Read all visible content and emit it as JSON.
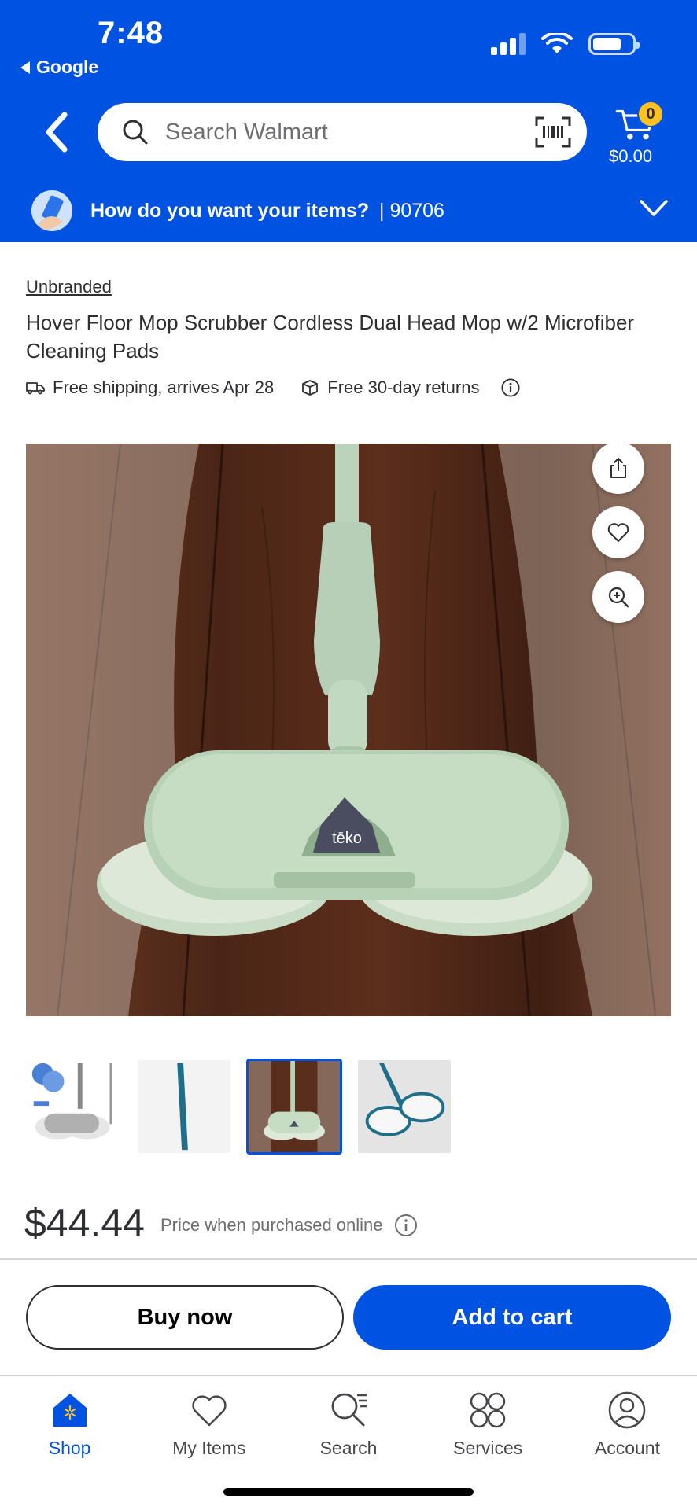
{
  "status_bar": {
    "time": "7:48",
    "back_app": "Google"
  },
  "header": {
    "search_placeholder": "Search Walmart",
    "cart_count": "0",
    "cart_total": "$0.00",
    "delivery_prompt": "How do you want your items?",
    "delivery_zip": "| 90706"
  },
  "product": {
    "brand": "Unbranded",
    "title": "Hover Floor Mop Scrubber Cordless Dual Head Mop w/2 Microfiber Cleaning Pads",
    "shipping": "Free shipping, arrives Apr 28",
    "returns": "Free 30-day returns",
    "image_logo_text": "tēko",
    "price": "$44.44",
    "price_note": "Price when purchased online",
    "thumbnails_count": 4,
    "selected_thumbnail": 3
  },
  "actions": {
    "buy_now": "Buy now",
    "add_to_cart": "Add to cart"
  },
  "tabbar": [
    {
      "label": "Shop",
      "active": true
    },
    {
      "label": "My Items",
      "active": false
    },
    {
      "label": "Search",
      "active": false
    },
    {
      "label": "Services",
      "active": false
    },
    {
      "label": "Account",
      "active": false
    }
  ],
  "colors": {
    "brand_blue": "#0052e0",
    "cart_badge": "#ffc220",
    "mop_green": "#bcd6bd",
    "floor_wood": "#5a2e1c"
  }
}
